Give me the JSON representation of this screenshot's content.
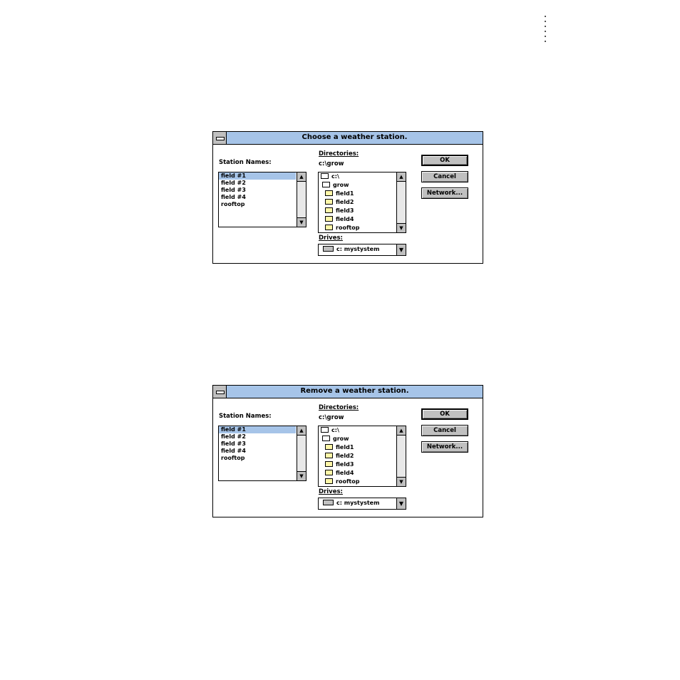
{
  "dialogs": [
    {
      "title": "Choose a weather station.",
      "station_label": "Station Names:",
      "stations": [
        "field #1",
        "field #2",
        "field #3",
        "field #4",
        "rooftop"
      ],
      "directories_label": "Directories:",
      "current_path": "c:\\grow",
      "directories": [
        "c:\\",
        "grow",
        "field1",
        "field2",
        "field3",
        "field4",
        "rooftop"
      ],
      "drives_label": "Drives:",
      "drive": "c: mystystem",
      "ok": "OK",
      "cancel": "Cancel",
      "network": "Network..."
    },
    {
      "title": "Remove a weather station.",
      "station_label": "Station Names:",
      "stations": [
        "field #1",
        "field #2",
        "field #3",
        "field #4",
        "rooftop"
      ],
      "directories_label": "Directories:",
      "current_path": "c:\\grow",
      "directories": [
        "c:\\",
        "grow",
        "field1",
        "field2",
        "field3",
        "field4",
        "rooftop"
      ],
      "drives_label": "Drives:",
      "drive": "c: mystystem",
      "ok": "OK",
      "cancel": "Cancel",
      "network": "Network..."
    }
  ],
  "icons": {
    "system_menu": "system-menu-icon",
    "folder": "folder-icon",
    "open_folder": "open-folder-icon",
    "drive": "drive-icon",
    "scroll_up": "scroll-up-arrow",
    "scroll_down": "scroll-down-arrow",
    "combo": "combo-arrow"
  },
  "colors": {
    "title_bar": "#a6c4e8",
    "selection": "#a6c4e8",
    "button_face": "#c0c0c0",
    "folder": "#fff7a8"
  }
}
